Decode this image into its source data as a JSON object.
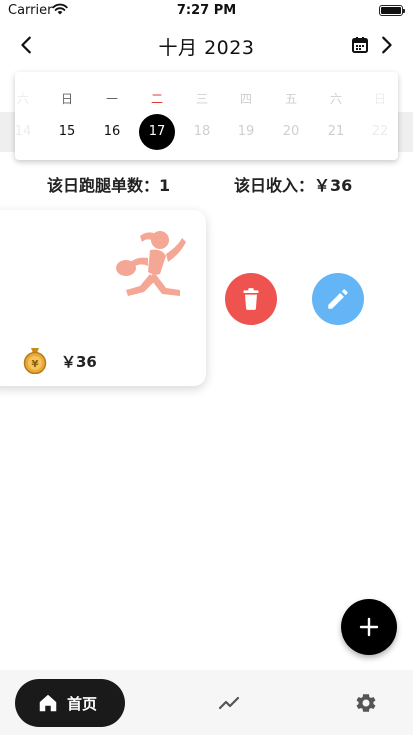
{
  "status_bar": {
    "carrier": "Carrier",
    "time": "7:27 PM"
  },
  "header": {
    "month_title": "十月 2023"
  },
  "week": {
    "days": [
      {
        "weekday": "六",
        "day": "14"
      },
      {
        "weekday": "日",
        "day": "15"
      },
      {
        "weekday": "一",
        "day": "16"
      },
      {
        "weekday": "二",
        "day": "17"
      },
      {
        "weekday": "三",
        "day": "18"
      },
      {
        "weekday": "四",
        "day": "19"
      },
      {
        "weekday": "五",
        "day": "20"
      },
      {
        "weekday": "六",
        "day": "21"
      },
      {
        "weekday": "日",
        "day": "22"
      }
    ]
  },
  "summary": {
    "order_count": "该日跑腿单数：1",
    "income": "该日收入：￥36"
  },
  "order": {
    "amount": "￥36"
  },
  "colors": {
    "delete": "#ef5350",
    "edit": "#64b5f6",
    "runner": "#f4a795",
    "coin": "#e8a93a",
    "selected": "#000000",
    "weekday_highlight": "#e53935"
  },
  "icons": {
    "back": "chevron-left-icon",
    "calendar": "calendar-icon",
    "next": "chevron-right-icon",
    "runner": "runner-icon",
    "coin": "coin-bag-icon",
    "delete": "trash-icon",
    "edit": "pencil-icon",
    "add": "plus-icon",
    "home": "home-icon",
    "stats": "trending-icon",
    "settings": "gear-icon"
  },
  "bottom_nav": {
    "home_label": "首页"
  }
}
